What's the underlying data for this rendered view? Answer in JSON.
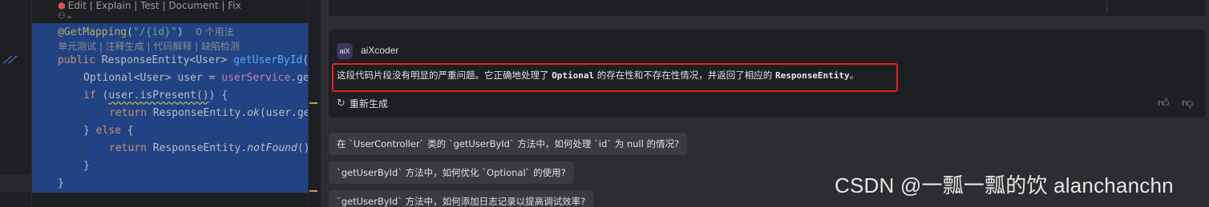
{
  "editor": {
    "codelens_top": "Edit | Explain | Test | Document | Fix",
    "codelens_ai": "单元测试 | 注释生成 | 代码解释 | 缺陷检测",
    "usage_hint": "0 个用法",
    "gutter_icon": "ai-gutter-icon",
    "lines": {
      "l1_annotation": "@GetMapping",
      "l1_open": "(",
      "l1_string": "\"/{id}\"",
      "l1_close": ")",
      "l3_public": "public",
      "l3_type": " ResponseEntity<User> ",
      "l3_method": "getUserById",
      "l3_rest": "(@",
      "l4_type": "Optional<User> user = ",
      "l4_field": "userService",
      "l4_rest": ".get",
      "l5_if": "if",
      "l5_open": " (",
      "l5_cond": "user.isPresent()",
      "l5_close": ") {",
      "l6_return": "return",
      "l6_a": " ResponseEntity.",
      "l6_ok": "ok",
      "l6_b": "(user.get",
      "l7": "} ",
      "l7_else": "else",
      "l7_brace": " {",
      "l8_return": "return",
      "l8_a": " ResponseEntity.",
      "l8_nf": "notFound",
      "l8_b": "().",
      "l9": "}",
      "l10": "}"
    }
  },
  "chat": {
    "bot_name": "aiXcoder",
    "avatar_text": "aiX",
    "reply": {
      "p1": "这段代码片段没有明显的严重问题。它正确地处理了 ",
      "c1": "Optional",
      "p2": " 的存在性和不存在性情况，并返回了相应的 ",
      "c2": "ResponseEntity",
      "p3": "。"
    },
    "regenerate_label": "重新生成",
    "suggestions": [
      "在 `UserController` 类的 `getUserById` 方法中，如何处理 `id` 为 null 的情况?",
      "`getUserById` 方法中，如何优化 `Optional` 的使用?",
      "`getUserById` 方法中，如何添加日志记录以提高调试效率?"
    ]
  },
  "watermark": "CSDN @一瓢一瓢的饮 alanchanchn",
  "colors": {
    "selection": "#214283",
    "highlight_box": "#e02424",
    "chat_bg": "#2b2d30",
    "editor_bg": "#1e1f22"
  }
}
